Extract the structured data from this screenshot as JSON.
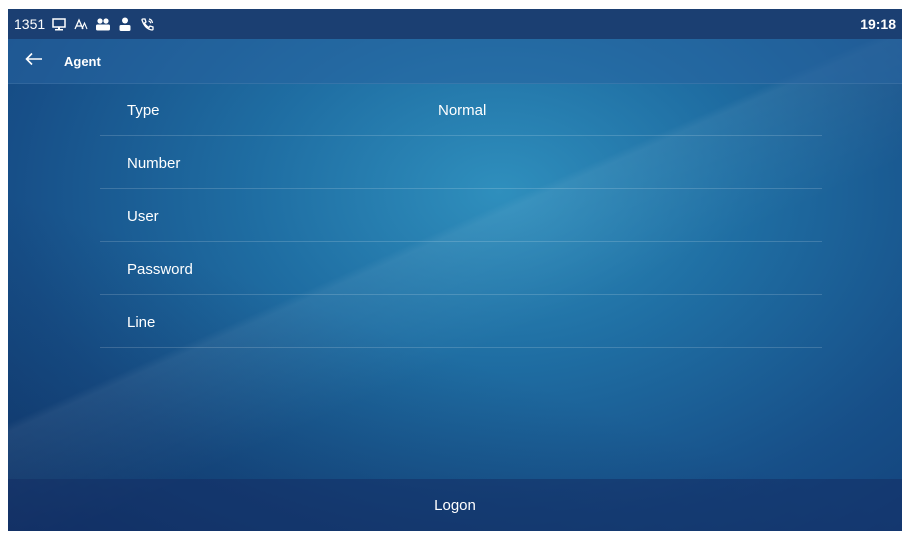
{
  "status_bar": {
    "left_text": "1351",
    "time": "19:18",
    "icons": [
      "monitor-icon",
      "text-size-icon",
      "users-icon",
      "user-icon",
      "phone-ring-icon"
    ]
  },
  "title_bar": {
    "back_icon": "arrow-left-icon",
    "title": "Agent"
  },
  "fields": [
    {
      "label": "Type",
      "value": "Normal"
    },
    {
      "label": "Number",
      "value": ""
    },
    {
      "label": "User",
      "value": ""
    },
    {
      "label": "Password",
      "value": ""
    },
    {
      "label": "Line",
      "value": ""
    }
  ],
  "logon_button": {
    "label": "Logon"
  }
}
